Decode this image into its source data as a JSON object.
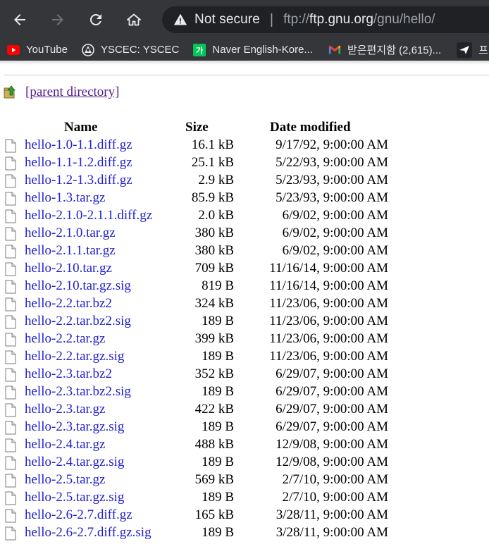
{
  "browser": {
    "security_label": "Not secure",
    "url_scheme": "ftp://",
    "url_host": "ftp.gnu.org",
    "url_path": "/gnu/hello/"
  },
  "bookmarks": [
    {
      "label": "YouTube",
      "icon": "youtube-icon",
      "color": "#ff0000"
    },
    {
      "label": "YSCEC: YSCEC",
      "icon": "yscec-icon",
      "color": "#ffffff"
    },
    {
      "label": "Naver English-Kore...",
      "icon": "naver-dictionary-icon",
      "color": "#03c75a"
    },
    {
      "label": "받은편지함 (2,615)...",
      "icon": "gmail-icon",
      "color": "#ea4335"
    },
    {
      "label": "프",
      "icon": "bookmark-icon",
      "color": "#ffffff"
    }
  ],
  "listing": {
    "parent_label": "[parent directory]",
    "headers": {
      "name": "Name",
      "size": "Size",
      "date": "Date modified"
    },
    "files": [
      {
        "name": "hello-1.0-1.1.diff.gz",
        "size": "16.1 kB",
        "date": "9/17/92, 9:00:00 AM"
      },
      {
        "name": "hello-1.1-1.2.diff.gz",
        "size": "25.1 kB",
        "date": "5/22/93, 9:00:00 AM"
      },
      {
        "name": "hello-1.2-1.3.diff.gz",
        "size": "2.9 kB",
        "date": "5/23/93, 9:00:00 AM"
      },
      {
        "name": "hello-1.3.tar.gz",
        "size": "85.9 kB",
        "date": "5/23/93, 9:00:00 AM"
      },
      {
        "name": "hello-2.1.0-2.1.1.diff.gz",
        "size": "2.0 kB",
        "date": "6/9/02, 9:00:00 AM"
      },
      {
        "name": "hello-2.1.0.tar.gz",
        "size": "380 kB",
        "date": "6/9/02, 9:00:00 AM"
      },
      {
        "name": "hello-2.1.1.tar.gz",
        "size": "380 kB",
        "date": "6/9/02, 9:00:00 AM"
      },
      {
        "name": "hello-2.10.tar.gz",
        "size": "709 kB",
        "date": "11/16/14, 9:00:00 AM"
      },
      {
        "name": "hello-2.10.tar.gz.sig",
        "size": "819 B",
        "date": "11/16/14, 9:00:00 AM"
      },
      {
        "name": "hello-2.2.tar.bz2",
        "size": "324 kB",
        "date": "11/23/06, 9:00:00 AM"
      },
      {
        "name": "hello-2.2.tar.bz2.sig",
        "size": "189 B",
        "date": "11/23/06, 9:00:00 AM"
      },
      {
        "name": "hello-2.2.tar.gz",
        "size": "399 kB",
        "date": "11/23/06, 9:00:00 AM"
      },
      {
        "name": "hello-2.2.tar.gz.sig",
        "size": "189 B",
        "date": "11/23/06, 9:00:00 AM"
      },
      {
        "name": "hello-2.3.tar.bz2",
        "size": "352 kB",
        "date": "6/29/07, 9:00:00 AM"
      },
      {
        "name": "hello-2.3.tar.bz2.sig",
        "size": "189 B",
        "date": "6/29/07, 9:00:00 AM"
      },
      {
        "name": "hello-2.3.tar.gz",
        "size": "422 kB",
        "date": "6/29/07, 9:00:00 AM"
      },
      {
        "name": "hello-2.3.tar.gz.sig",
        "size": "189 B",
        "date": "6/29/07, 9:00:00 AM"
      },
      {
        "name": "hello-2.4.tar.gz",
        "size": "488 kB",
        "date": "12/9/08, 9:00:00 AM"
      },
      {
        "name": "hello-2.4.tar.gz.sig",
        "size": "189 B",
        "date": "12/9/08, 9:00:00 AM"
      },
      {
        "name": "hello-2.5.tar.gz",
        "size": "569 kB",
        "date": "2/7/10, 9:00:00 AM"
      },
      {
        "name": "hello-2.5.tar.gz.sig",
        "size": "189 B",
        "date": "2/7/10, 9:00:00 AM"
      },
      {
        "name": "hello-2.6-2.7.diff.gz",
        "size": "165 kB",
        "date": "3/28/11, 9:00:00 AM"
      },
      {
        "name": "hello-2.6-2.7.diff.gz.sig",
        "size": "189 B",
        "date": "3/28/11, 9:00:00 AM"
      }
    ]
  },
  "colors": {
    "chrome_bg": "#35363a",
    "omnibox_bg": "#202124",
    "link": "#2020d0",
    "visited_link": "#551a8b"
  }
}
